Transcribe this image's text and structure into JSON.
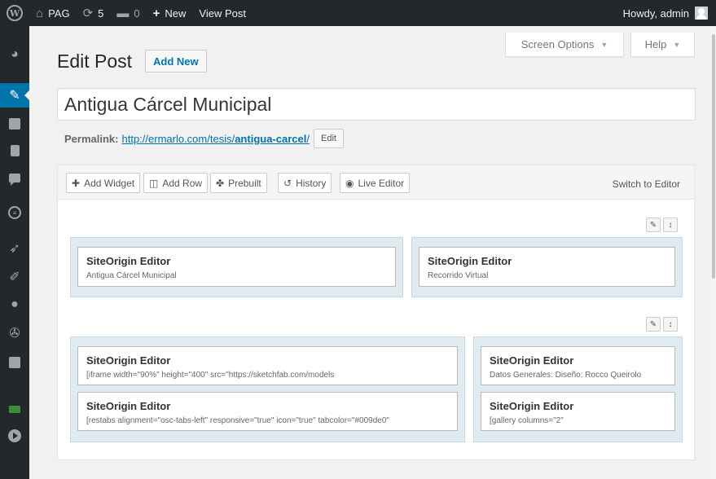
{
  "adminbar": {
    "site_name": "PAG",
    "updates_count": "5",
    "comments_count": "0",
    "new_label": "New",
    "view_post_label": "View Post",
    "howdy": "Howdy, admin"
  },
  "screen_meta": {
    "screen_options": "Screen Options",
    "help": "Help"
  },
  "page": {
    "title": "Edit Post",
    "add_new": "Add New"
  },
  "post": {
    "title": "Antigua Cárcel Municipal",
    "permalink_label": "Permalink:",
    "permalink_base": "http://ermarlo.com/tesis/",
    "permalink_slug": "antigua-carcel",
    "permalink_end": "/",
    "edit_label": "Edit"
  },
  "builder": {
    "toolbar": {
      "add_widget": "Add Widget",
      "add_row": "Add Row",
      "prebuilt": "Prebuilt",
      "history": "History",
      "live_editor": "Live Editor",
      "switch_editor": "Switch to Editor"
    },
    "rows": [
      {
        "cells": [
          {
            "widgets": [
              {
                "title": "SiteOrigin Editor",
                "desc": "Antigua Cárcel Municipal"
              }
            ]
          },
          {
            "widgets": [
              {
                "title": "SiteOrigin Editor",
                "desc": "Recorrido Virtual"
              }
            ]
          }
        ]
      },
      {
        "cells": [
          {
            "widgets": [
              {
                "title": "SiteOrigin Editor",
                "desc": "[iframe width=\"90%\" height=\"400\" src=\"https://sketchfab.com/models"
              },
              {
                "title": "SiteOrigin Editor",
                "desc": "[restabs alignment=\"osc-tabs-left\" responsive=\"true\" icon=\"true\" tabcolor=\"#009de0\""
              }
            ]
          },
          {
            "widgets": [
              {
                "title": "SiteOrigin Editor",
                "desc": "Datos Generales: Diseño: Rocco Queirolo"
              },
              {
                "title": "SiteOrigin Editor",
                "desc": "[gallery columns=\"2\""
              }
            ]
          }
        ]
      }
    ]
  },
  "colors": {
    "adminbar_bg": "#23282d",
    "accent": "#0073aa",
    "cell_bg": "#dfeaf1"
  }
}
